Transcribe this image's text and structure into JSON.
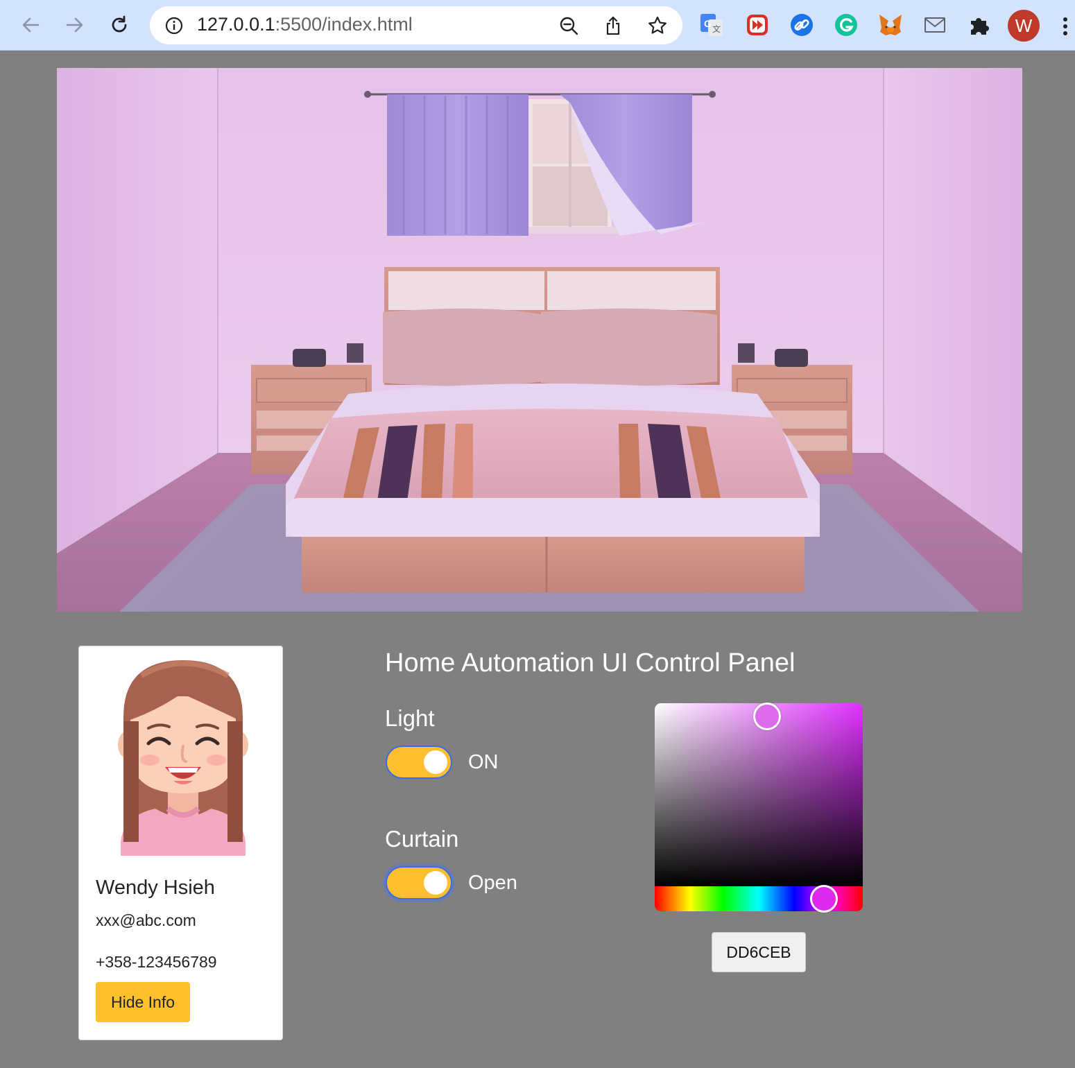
{
  "browser": {
    "url_host": "127.0.0.1",
    "url_rest": ":5500/index.html",
    "profile_initial": "W"
  },
  "profile": {
    "name": "Wendy Hsieh",
    "email": "xxx@abc.com",
    "phone": "+358-123456789",
    "hide_button": "Hide Info"
  },
  "panel": {
    "title": "Home Automation UI Control Panel",
    "light": {
      "label": "Light",
      "state": "ON",
      "on": true
    },
    "curtain": {
      "label": "Curtain",
      "state": "Open",
      "on": true
    },
    "color": {
      "hex": "DD6CEB"
    }
  },
  "colors": {
    "toggle_on": "#fdbe2f",
    "hide_button": "#ffc02c",
    "page_background": "#808080",
    "selected_color": "#dd6ceb"
  }
}
